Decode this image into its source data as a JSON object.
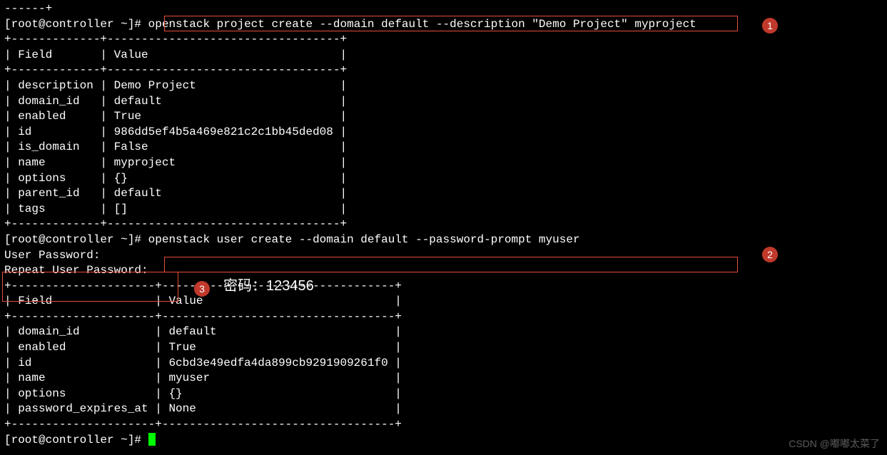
{
  "line0": "------+",
  "prompt": "[root@controller ~]#",
  "cmd1": "openstack project create --domain default --description \"Demo Project\" myproject",
  "table1": {
    "border": "+-------------+----------------------------------+",
    "header": "| Field       | Value                            |",
    "rows": [
      "| description | Demo Project                     |",
      "| domain_id   | default                          |",
      "| enabled     | True                             |",
      "| id          | 986dd5ef4b5a469e821c2c1bb45ded08 |",
      "| is_domain   | False                            |",
      "| name        | myproject                        |",
      "| options     | {}                               |",
      "| parent_id   | default                          |",
      "| tags        | []                               |"
    ]
  },
  "cmd2": "openstack user create --domain default --password-prompt myuser",
  "pw1": "User Password:",
  "pw2": "Repeat User Password:",
  "table2": {
    "border": "+---------------------+----------------------------------+",
    "header": "| Field               | Value                            |",
    "rows": [
      "| domain_id           | default                          |",
      "| enabled             | True                             |",
      "| id                  | 6cbd3e49edfa4da899cb9291909261f0 |",
      "| name                | myuser                           |",
      "| options             | {}                               |",
      "| password_expires_at | None                             |"
    ]
  },
  "badges": {
    "b1": "1",
    "b2": "2",
    "b3": "3"
  },
  "annotation": "密码：123456",
  "watermark": "CSDN @嘟嘟太菜了"
}
